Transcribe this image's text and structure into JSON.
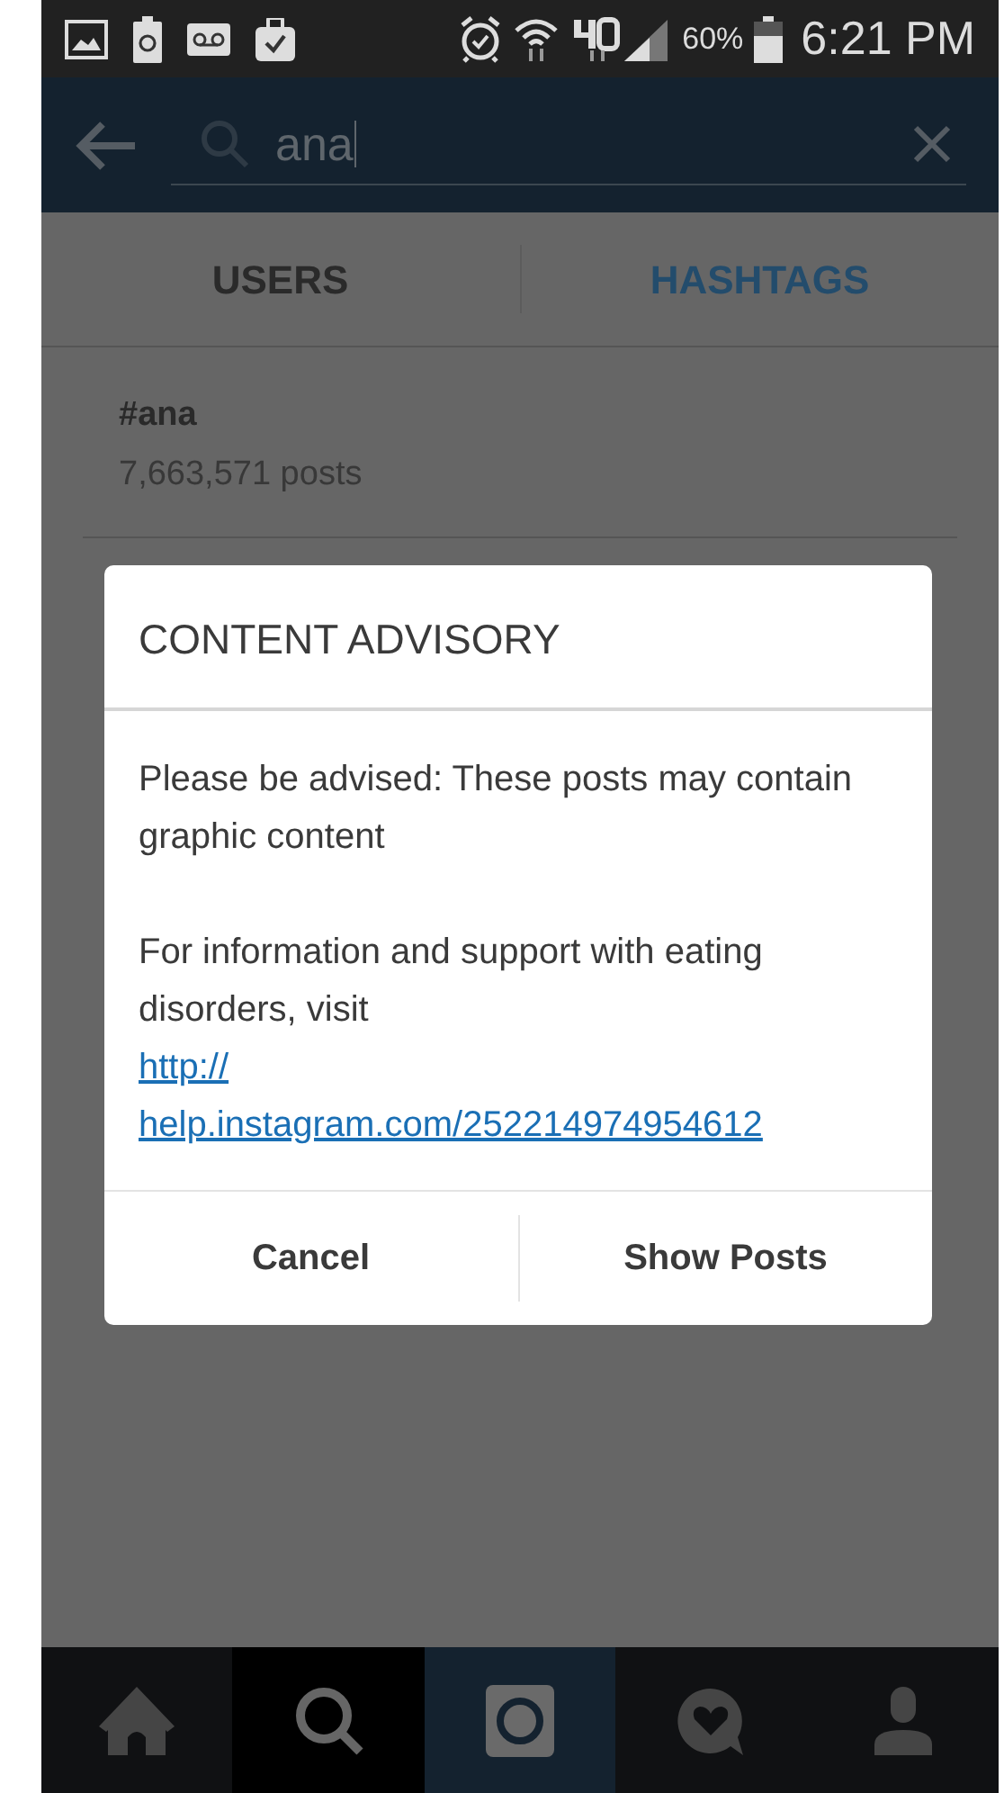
{
  "status_bar": {
    "battery": "60%",
    "time": "6:21 PM"
  },
  "search": {
    "value": "ana"
  },
  "tabs": [
    {
      "label": "USERS",
      "selected": false
    },
    {
      "label": "HASHTAGS",
      "selected": true
    }
  ],
  "results": [
    {
      "tag": "#ana",
      "count": "7,663,571 posts"
    }
  ],
  "dialog": {
    "title": "CONTENT ADVISORY",
    "message": "Please be advised: These posts may contain graphic content",
    "support_text": "For information and support with eating disorders, visit",
    "link_lines": [
      "http://",
      "help.instagram.com/252214974954612"
    ],
    "buttons": [
      "Cancel",
      "Show Posts"
    ]
  },
  "nav": [
    {
      "kind": "home",
      "selected": false
    },
    {
      "kind": "search",
      "selected": true
    },
    {
      "kind": "camera",
      "selected": false
    },
    {
      "kind": "activity",
      "selected": false
    },
    {
      "kind": "profile",
      "selected": false
    }
  ]
}
